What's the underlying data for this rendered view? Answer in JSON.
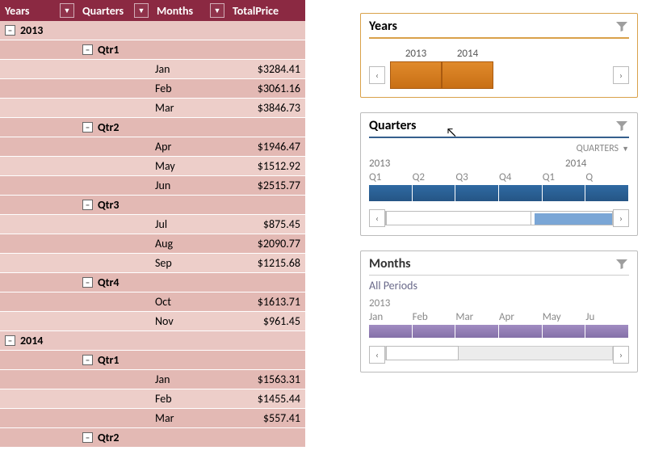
{
  "pivot": {
    "headers": {
      "years": "Years",
      "quarters": "Quarters",
      "months": "Months",
      "total": "TotalPrice"
    },
    "data": [
      {
        "year": "2013",
        "quarters": [
          {
            "name": "Qtr1",
            "months": [
              {
                "name": "Jan",
                "total": "$3284.41"
              },
              {
                "name": "Feb",
                "total": "$3061.16"
              },
              {
                "name": "Mar",
                "total": "$3846.73"
              }
            ]
          },
          {
            "name": "Qtr2",
            "months": [
              {
                "name": "Apr",
                "total": "$1946.47"
              },
              {
                "name": "May",
                "total": "$1512.92"
              },
              {
                "name": "Jun",
                "total": "$2515.77"
              }
            ]
          },
          {
            "name": "Qtr3",
            "months": [
              {
                "name": "Jul",
                "total": "$875.45"
              },
              {
                "name": "Aug",
                "total": "$2090.77"
              },
              {
                "name": "Sep",
                "total": "$1215.68"
              }
            ]
          },
          {
            "name": "Qtr4",
            "months": [
              {
                "name": "Oct",
                "total": "$1613.71"
              },
              {
                "name": "Nov",
                "total": "$961.45"
              }
            ]
          }
        ]
      },
      {
        "year": "2014",
        "quarters": [
          {
            "name": "Qtr1",
            "months": [
              {
                "name": "Jan",
                "total": "$1563.31"
              },
              {
                "name": "Feb",
                "total": "$1455.44"
              },
              {
                "name": "Mar",
                "total": "$557.41"
              }
            ]
          },
          {
            "name": "Qtr2",
            "months": []
          }
        ]
      }
    ]
  },
  "slicers": {
    "years": {
      "title": "Years",
      "items": [
        "2013",
        "2014"
      ]
    },
    "quarters": {
      "title": "Quarters",
      "level_label": "QUARTERS",
      "years": [
        "2013",
        "2014"
      ],
      "labels": [
        "Q1",
        "Q2",
        "Q3",
        "Q4",
        "Q1",
        "Q"
      ]
    },
    "months": {
      "title": "Months",
      "period": "All Periods",
      "year": "2013",
      "labels": [
        "Jan",
        "Feb",
        "Mar",
        "Apr",
        "May",
        "Ju"
      ]
    }
  },
  "nav": {
    "left": "‹",
    "right": "›"
  },
  "icons": {
    "collapse": "−",
    "dropdown": "▼"
  }
}
